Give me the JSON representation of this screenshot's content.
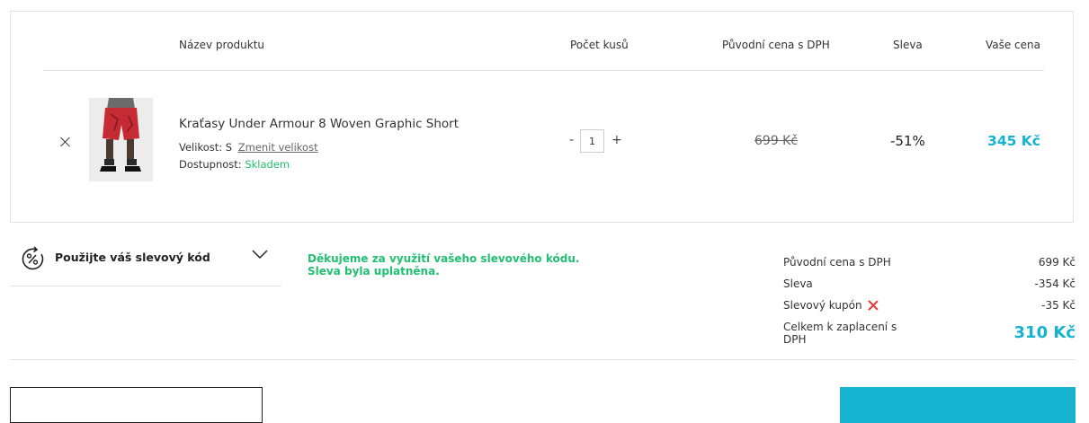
{
  "table_header": {
    "product": "Název produktu",
    "quantity": "Počet kusů",
    "original_price": "Původní cena s DPH",
    "discount": "Sleva",
    "your_price": "Vaše cena"
  },
  "item": {
    "name": "Kraťasy Under Armour 8 Woven Graphic Short",
    "size_label": "Velikost:",
    "size_value": "S",
    "change_size": "Zmenit velikost",
    "availability_label": "Dostupnost:",
    "availability_value": "Skladem",
    "qty_minus": "-",
    "qty_value": "1",
    "qty_plus": "+",
    "original_price": "699 Kč",
    "discount": "-51%",
    "price": "345 Kč"
  },
  "coupon": {
    "label": "Použijte váš slevový kód",
    "icon": "percent-rotate-icon",
    "thanks_line1": "Děkujeme za využití vašeho slevového kódu.",
    "thanks_line2": "Sleva byla uplatněna."
  },
  "summary": {
    "original_label": "Původní cena s DPH",
    "original_value": "699 Kč",
    "discount_label": "Sleva",
    "discount_value": "-354 Kč",
    "coupon_label": "Slevový kupón",
    "coupon_value": "-35 Kč",
    "total_label_line1": "Celkem k zaplacení s",
    "total_label_line2": "DPH",
    "total_value": "310 Kč"
  },
  "colors": {
    "accent": "#16b3d1",
    "success": "#21c070",
    "remove": "#e53935"
  }
}
